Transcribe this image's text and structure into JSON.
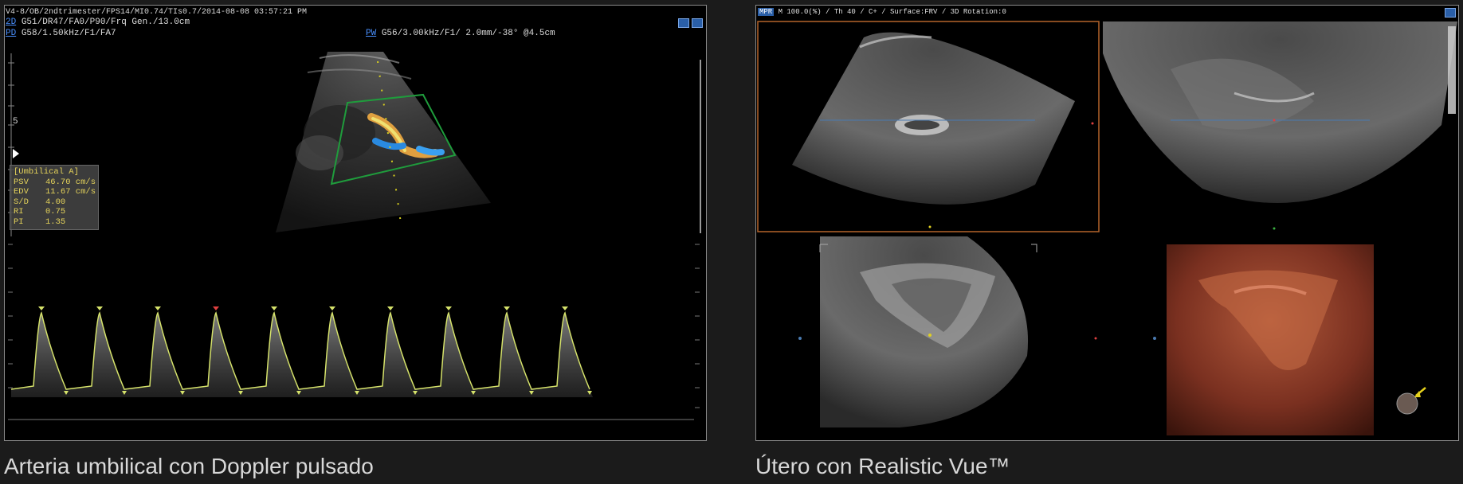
{
  "left_panel": {
    "header_line1": "V4-8/OB/2ndtrimester/FPS14/MI0.74/TIs0.7/2014-08-08 03:57:21 PM",
    "mode_2d_tag": "2D",
    "mode_2d_params": "G51/DR47/FA0/P90/Frq Gen./13.0cm",
    "mode_pd_tag": "PD",
    "mode_pd_params": "G58/1.50kHz/F1/FA7",
    "mode_pw_tag": "PW",
    "mode_pw_params": "G56/3.00kHz/F1/ 2.0mm/-38° @4.5cm",
    "depth_label": "5",
    "measurements": {
      "title": "[Umbilical A]",
      "rows": [
        {
          "key": "PSV",
          "value": "46.70 cm/s"
        },
        {
          "key": "EDV",
          "value": "11.67 cm/s"
        },
        {
          "key": "S/D",
          "value": "4.00"
        },
        {
          "key": "RI",
          "value": "0.75"
        },
        {
          "key": "PI",
          "value": "1.35"
        }
      ]
    },
    "caption": "Arteria umbilical con Doppler pulsado",
    "colors": {
      "measure_text": "#e4d25a",
      "doppler_trace": "#d6e36b",
      "roi_box": "#1f9c3c"
    }
  },
  "right_panel": {
    "header_tag": "MPR",
    "header_params": "M 100.0(%) / Th 40 / C+ / Surface:FRV / 3D Rotation:0",
    "caption": "Útero con Realistic Vue™",
    "colors": {
      "active_frame": "#b5642a",
      "render_tint": "#8a3a22",
      "marker_arrow": "#e6d21c"
    }
  }
}
